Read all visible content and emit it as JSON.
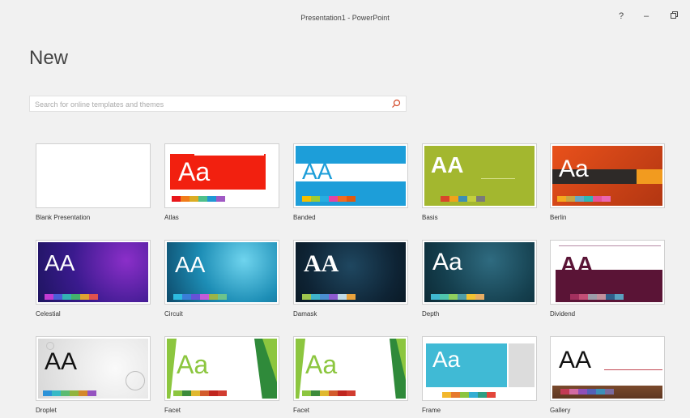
{
  "window": {
    "title": "Presentation1 - PowerPoint",
    "help": "?",
    "minimize": "–",
    "restore": "🗗"
  },
  "page": {
    "heading": "New"
  },
  "search": {
    "placeholder": "Search for online templates and themes"
  },
  "templates": [
    {
      "name": "Blank Presentation"
    },
    {
      "name": "Atlas",
      "aa": "Aa"
    },
    {
      "name": "Banded",
      "aa": "AA"
    },
    {
      "name": "Basis",
      "aa": "AA"
    },
    {
      "name": "Berlin",
      "aa": "Aa"
    },
    {
      "name": "Celestial",
      "aa": "AA"
    },
    {
      "name": "Circuit",
      "aa": "AA"
    },
    {
      "name": "Damask",
      "aa": "AA"
    },
    {
      "name": "Depth",
      "aa": "Aa"
    },
    {
      "name": "Dividend",
      "aa": "AA"
    },
    {
      "name": "Droplet",
      "aa": "AA"
    },
    {
      "name": "Facet",
      "aa": "Aa"
    },
    {
      "name": "Facet",
      "aa": "Aa"
    },
    {
      "name": "Frame",
      "aa": "Aa"
    },
    {
      "name": "Gallery",
      "aa": "AA"
    }
  ],
  "colors": {
    "accent": "#d24726"
  }
}
